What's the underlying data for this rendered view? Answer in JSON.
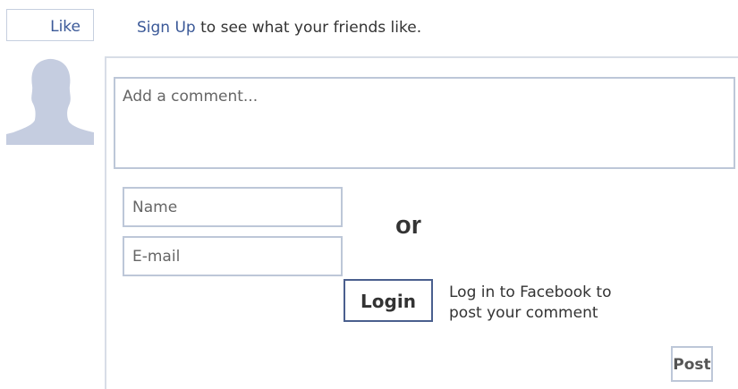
{
  "like_button": {
    "label": "Like"
  },
  "signup": {
    "link_text": "Sign Up",
    "rest_text": " to see what your friends like."
  },
  "avatar": {
    "icon": "default-profile-silhouette",
    "color": "#c5cde0"
  },
  "comment": {
    "placeholder": "Add a comment..."
  },
  "form": {
    "name_placeholder": "Name",
    "email_placeholder": "E-mail",
    "or_text": "or",
    "login_label": "Login",
    "login_hint_line1": "Log in to Facebook to",
    "login_hint_line2": "post your comment",
    "post_label": "Post"
  },
  "colors": {
    "link": "#3b5998",
    "border": "#bdc7d8",
    "login_border": "#4a5f8e"
  }
}
